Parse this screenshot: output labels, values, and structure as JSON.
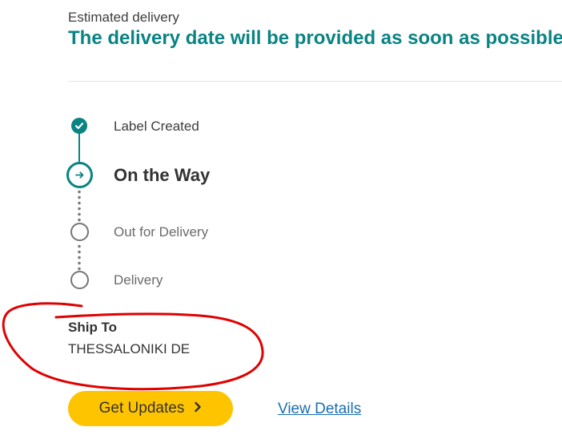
{
  "estimate": {
    "label": "Estimated delivery",
    "message": "The delivery date will be provided as soon as possible."
  },
  "timeline": {
    "steps": [
      {
        "label": "Label Created",
        "status": "completed",
        "icon": "check-icon"
      },
      {
        "label": "On the Way",
        "status": "current",
        "icon": "arrow-right-icon"
      },
      {
        "label": "Out for Delivery",
        "status": "pending",
        "icon": "empty-circle-icon"
      },
      {
        "label": "Delivery",
        "status": "pending",
        "icon": "empty-circle-icon"
      }
    ]
  },
  "ship_to": {
    "heading": "Ship To",
    "value": "THESSALONIKI DE"
  },
  "actions": {
    "get_updates_label": "Get Updates",
    "get_updates_icon": "chevron-right-icon",
    "view_details_label": "View Details"
  },
  "colors": {
    "accent": "#0a8383",
    "button": "#ffc400",
    "link": "#1a6fb0",
    "annotation": "#e00000"
  }
}
